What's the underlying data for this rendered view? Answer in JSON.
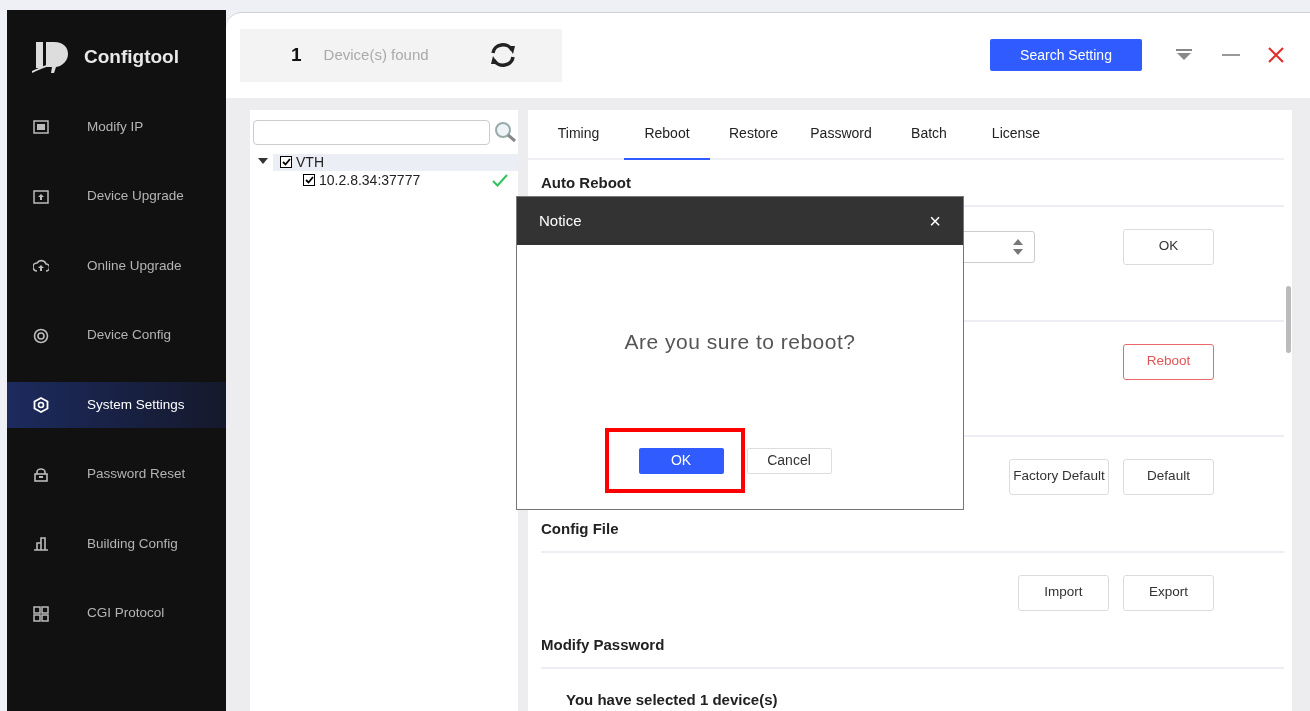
{
  "app": {
    "logo_text": "Configtool"
  },
  "sidebar": {
    "items": [
      {
        "label": "Modify IP",
        "selected": false
      },
      {
        "label": "Device Upgrade",
        "selected": false
      },
      {
        "label": "Online Upgrade",
        "selected": false
      },
      {
        "label": "Device Config",
        "selected": false
      },
      {
        "label": "System Settings",
        "selected": true
      },
      {
        "label": "Password Reset",
        "selected": false
      },
      {
        "label": "Building Config",
        "selected": false
      },
      {
        "label": "CGI Protocol",
        "selected": false
      }
    ]
  },
  "header": {
    "count": "1",
    "count_label": "Device(s) found",
    "search_button": "Search Setting"
  },
  "device_tree": {
    "nodes": [
      {
        "label": "VTH",
        "checked": true,
        "expanded": true,
        "children": [
          {
            "label": "10.2.8.34:37777",
            "checked": true,
            "connected": true
          }
        ]
      }
    ]
  },
  "tabs": [
    {
      "label": "Timing",
      "selected": false
    },
    {
      "label": "Reboot",
      "selected": true
    },
    {
      "label": "Restore",
      "selected": false
    },
    {
      "label": "Password",
      "selected": false
    },
    {
      "label": "Batch",
      "selected": false
    },
    {
      "label": "License",
      "selected": false
    }
  ],
  "rows": [
    {
      "kind": "heading",
      "text": "Auto Reboot"
    },
    {
      "kind": "controls",
      "spinner": true,
      "buttons": [
        {
          "label": "OK",
          "kind": "normal"
        }
      ]
    },
    {
      "kind": "controls",
      "spinner": false,
      "buttons": [
        {
          "label": "Reboot",
          "kind": "danger"
        }
      ]
    },
    {
      "kind": "controls",
      "spinner": false,
      "buttons": [
        {
          "label": "Factory Default",
          "kind": "normal"
        },
        {
          "label": "Default",
          "kind": "normal"
        }
      ]
    },
    {
      "kind": "heading",
      "text": "Config File"
    },
    {
      "kind": "controls",
      "spinner": false,
      "buttons": [
        {
          "label": "Import",
          "kind": "normal"
        },
        {
          "label": "Export",
          "kind": "normal"
        }
      ]
    },
    {
      "kind": "heading",
      "text": "Modify Password"
    },
    {
      "kind": "text",
      "text": "You have selected 1 device(s)"
    }
  ],
  "dialog": {
    "title": "Notice",
    "close": "×",
    "message": "Are you sure to reboot?",
    "buttons": [
      {
        "label": "OK",
        "kind": "primary",
        "highlighted": true
      },
      {
        "label": "Cancel",
        "kind": "normal",
        "highlighted": false
      }
    ]
  }
}
